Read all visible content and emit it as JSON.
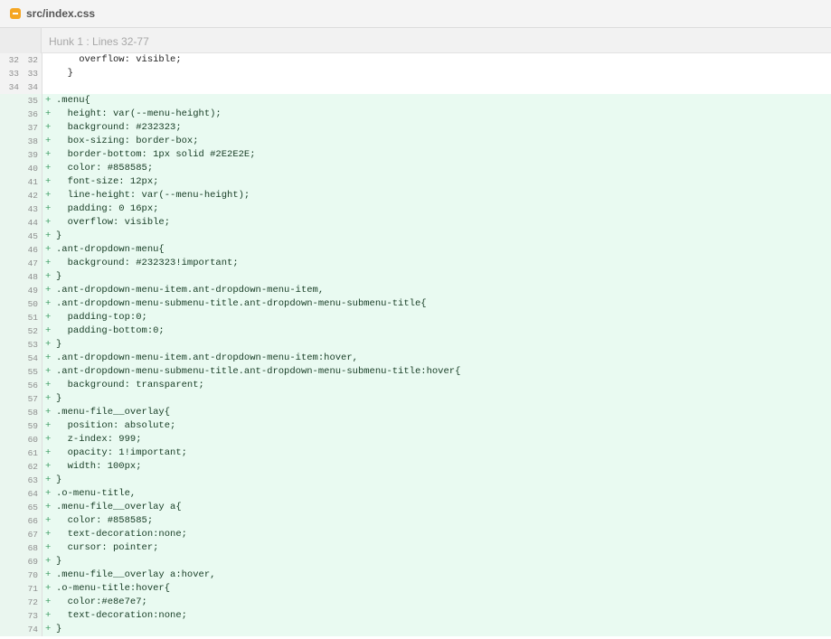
{
  "file": {
    "name": "src/index.css",
    "icon": "css-file-icon",
    "icon_color": "#f5a623"
  },
  "hunk": {
    "label": "Hunk 1 : Lines 32-77"
  },
  "colors": {
    "added_bg": "#e9faf1",
    "context_bg": "#ffffff",
    "add_sign": "#3c9a61"
  },
  "lines": [
    {
      "type": "ctx",
      "old": "32",
      "new": "32",
      "sign": "",
      "text": "    overflow: visible;"
    },
    {
      "type": "ctx",
      "old": "33",
      "new": "33",
      "sign": "",
      "text": "  }"
    },
    {
      "type": "ctx",
      "old": "34",
      "new": "34",
      "sign": "",
      "text": ""
    },
    {
      "type": "add",
      "old": "",
      "new": "35",
      "sign": "+",
      "text": ".menu{"
    },
    {
      "type": "add",
      "old": "",
      "new": "36",
      "sign": "+",
      "text": "  height: var(--menu-height);"
    },
    {
      "type": "add",
      "old": "",
      "new": "37",
      "sign": "+",
      "text": "  background: #232323;"
    },
    {
      "type": "add",
      "old": "",
      "new": "38",
      "sign": "+",
      "text": "  box-sizing: border-box;"
    },
    {
      "type": "add",
      "old": "",
      "new": "39",
      "sign": "+",
      "text": "  border-bottom: 1px solid #2E2E2E;"
    },
    {
      "type": "add",
      "old": "",
      "new": "40",
      "sign": "+",
      "text": "  color: #858585;"
    },
    {
      "type": "add",
      "old": "",
      "new": "41",
      "sign": "+",
      "text": "  font-size: 12px;"
    },
    {
      "type": "add",
      "old": "",
      "new": "42",
      "sign": "+",
      "text": "  line-height: var(--menu-height);"
    },
    {
      "type": "add",
      "old": "",
      "new": "43",
      "sign": "+",
      "text": "  padding: 0 16px;"
    },
    {
      "type": "add",
      "old": "",
      "new": "44",
      "sign": "+",
      "text": "  overflow: visible;"
    },
    {
      "type": "add",
      "old": "",
      "new": "45",
      "sign": "+",
      "text": "}"
    },
    {
      "type": "add",
      "old": "",
      "new": "46",
      "sign": "+",
      "text": ".ant-dropdown-menu{"
    },
    {
      "type": "add",
      "old": "",
      "new": "47",
      "sign": "+",
      "text": "  background: #232323!important;"
    },
    {
      "type": "add",
      "old": "",
      "new": "48",
      "sign": "+",
      "text": "}"
    },
    {
      "type": "add",
      "old": "",
      "new": "49",
      "sign": "+",
      "text": ".ant-dropdown-menu-item.ant-dropdown-menu-item,"
    },
    {
      "type": "add",
      "old": "",
      "new": "50",
      "sign": "+",
      "text": ".ant-dropdown-menu-submenu-title.ant-dropdown-menu-submenu-title{"
    },
    {
      "type": "add",
      "old": "",
      "new": "51",
      "sign": "+",
      "text": "  padding-top:0;"
    },
    {
      "type": "add",
      "old": "",
      "new": "52",
      "sign": "+",
      "text": "  padding-bottom:0;"
    },
    {
      "type": "add",
      "old": "",
      "new": "53",
      "sign": "+",
      "text": "}"
    },
    {
      "type": "add",
      "old": "",
      "new": "54",
      "sign": "+",
      "text": ".ant-dropdown-menu-item.ant-dropdown-menu-item:hover,"
    },
    {
      "type": "add",
      "old": "",
      "new": "55",
      "sign": "+",
      "text": ".ant-dropdown-menu-submenu-title.ant-dropdown-menu-submenu-title:hover{"
    },
    {
      "type": "add",
      "old": "",
      "new": "56",
      "sign": "+",
      "text": "  background: transparent;"
    },
    {
      "type": "add",
      "old": "",
      "new": "57",
      "sign": "+",
      "text": "}"
    },
    {
      "type": "add",
      "old": "",
      "new": "58",
      "sign": "+",
      "text": ".menu-file__overlay{"
    },
    {
      "type": "add",
      "old": "",
      "new": "59",
      "sign": "+",
      "text": "  position: absolute;"
    },
    {
      "type": "add",
      "old": "",
      "new": "60",
      "sign": "+",
      "text": "  z-index: 999;"
    },
    {
      "type": "add",
      "old": "",
      "new": "61",
      "sign": "+",
      "text": "  opacity: 1!important;"
    },
    {
      "type": "add",
      "old": "",
      "new": "62",
      "sign": "+",
      "text": "  width: 100px;"
    },
    {
      "type": "add",
      "old": "",
      "new": "63",
      "sign": "+",
      "text": "}"
    },
    {
      "type": "add",
      "old": "",
      "new": "64",
      "sign": "+",
      "text": ".o-menu-title,"
    },
    {
      "type": "add",
      "old": "",
      "new": "65",
      "sign": "+",
      "text": ".menu-file__overlay a{"
    },
    {
      "type": "add",
      "old": "",
      "new": "66",
      "sign": "+",
      "text": "  color: #858585;"
    },
    {
      "type": "add",
      "old": "",
      "new": "67",
      "sign": "+",
      "text": "  text-decoration:none;"
    },
    {
      "type": "add",
      "old": "",
      "new": "68",
      "sign": "+",
      "text": "  cursor: pointer;"
    },
    {
      "type": "add",
      "old": "",
      "new": "69",
      "sign": "+",
      "text": "}"
    },
    {
      "type": "add",
      "old": "",
      "new": "70",
      "sign": "+",
      "text": ".menu-file__overlay a:hover,"
    },
    {
      "type": "add",
      "old": "",
      "new": "71",
      "sign": "+",
      "text": ".o-menu-title:hover{"
    },
    {
      "type": "add",
      "old": "",
      "new": "72",
      "sign": "+",
      "text": "  color:#e8e7e7;"
    },
    {
      "type": "add",
      "old": "",
      "new": "73",
      "sign": "+",
      "text": "  text-decoration:none;"
    },
    {
      "type": "add",
      "old": "",
      "new": "74",
      "sign": "+",
      "text": "}"
    }
  ]
}
